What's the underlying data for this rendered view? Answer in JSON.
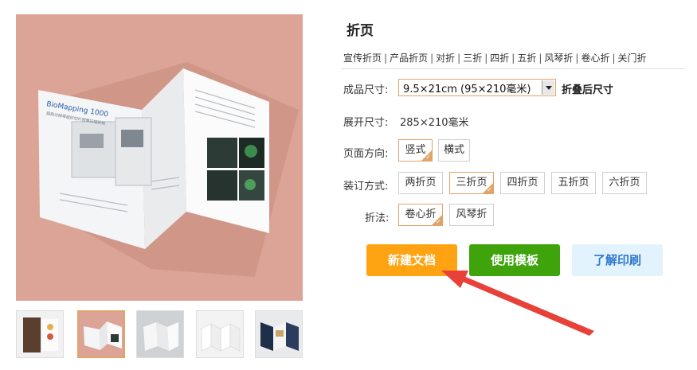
{
  "product": {
    "title": "折页",
    "types": [
      "宣传折页",
      "产品折页",
      "对折",
      "三折",
      "四折",
      "五折",
      "风琴折",
      "卷心折",
      "关门折"
    ],
    "separator": "|"
  },
  "gallery": {
    "main_alt": "tri-fold brochure mockup",
    "brochure_text": "BioMapping 1000",
    "brochure_subtitle": "超高分辨率组织切片图像扫描系统",
    "thumbnails": [
      "brochure-dark",
      "brochure-trifold",
      "brochure-gray",
      "brochure-accordion",
      "brochure-blue"
    ],
    "active_thumb": 1
  },
  "form": {
    "finished_size_label": "成品尺寸:",
    "finished_size_value": "9.5×21cm (95×210毫米)",
    "finished_size_note": "折叠后尺寸",
    "unfold_label": "展开尺寸:",
    "unfold_value": "285×210毫米",
    "orientation_label": "页面方向:",
    "orientation_options": [
      "竖式",
      "横式"
    ],
    "orientation_selected": "竖式",
    "binding_label": "装订方式:",
    "binding_options": [
      "两折页",
      "三折页",
      "四折页",
      "五折页",
      "六折页"
    ],
    "binding_selected": "三折页",
    "fold_label": "折法:",
    "fold_options": [
      "卷心折",
      "风琴折"
    ],
    "fold_selected": "卷心折",
    "check_glyph": "✓"
  },
  "actions": {
    "new_doc": "新建文档",
    "use_template": "使用模板",
    "learn_print": "了解印刷"
  },
  "colors": {
    "accent": "#e0a36a",
    "new_doc_bg": "#ffa312",
    "template_bg": "#3fa30c",
    "learn_bg": "#e3f3fd",
    "annotation_arrow": "#e8413a"
  }
}
